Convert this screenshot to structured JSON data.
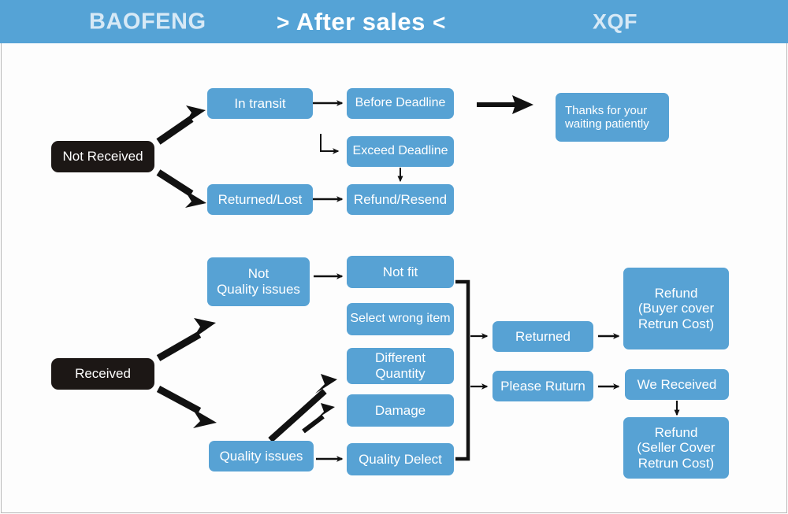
{
  "header": {
    "left_brand": "BAOFENG",
    "title_prefix": ">",
    "title": "After sales",
    "title_suffix": "<",
    "right_brand": "XQF",
    "bg_color": "#55a3d6",
    "brand_text_color": "#d7e9f6",
    "title_color": "#ffffff"
  },
  "theme": {
    "node_blue": "#57a2d4",
    "node_black": "#1c1715",
    "node_text": "#ffffff",
    "connector": "#111111",
    "page_bg": "#fdfdfd",
    "frame_border": "#b9b9b9"
  },
  "flow": {
    "not_received": {
      "root": "Not Received",
      "in_transit": "In transit",
      "before_deadline": "Before Deadline",
      "exceed_deadline": "Exceed Deadline",
      "returned_lost": "Returned/Lost",
      "refund_resend": "Refund/Resend",
      "thanks": "Thanks for your\nwaiting patiently"
    },
    "received": {
      "root": "Received",
      "not_quality_issues": "Not\nQuality issues",
      "quality_issues": "Quality issues",
      "not_fit": "Not fit",
      "select_wrong_item": "Select wrong item",
      "different_quantity": "Different\nQuantity",
      "damage": "Damage",
      "quality_delect": "Quality Delect",
      "returned": "Returned",
      "please_return": "Please Ruturn",
      "refund_buyer": "Refund\n(Buyer cover\nRetrun Cost)",
      "we_received": "We Received",
      "refund_seller": "Refund\n(Seller Cover\nRetrun Cost)"
    }
  }
}
